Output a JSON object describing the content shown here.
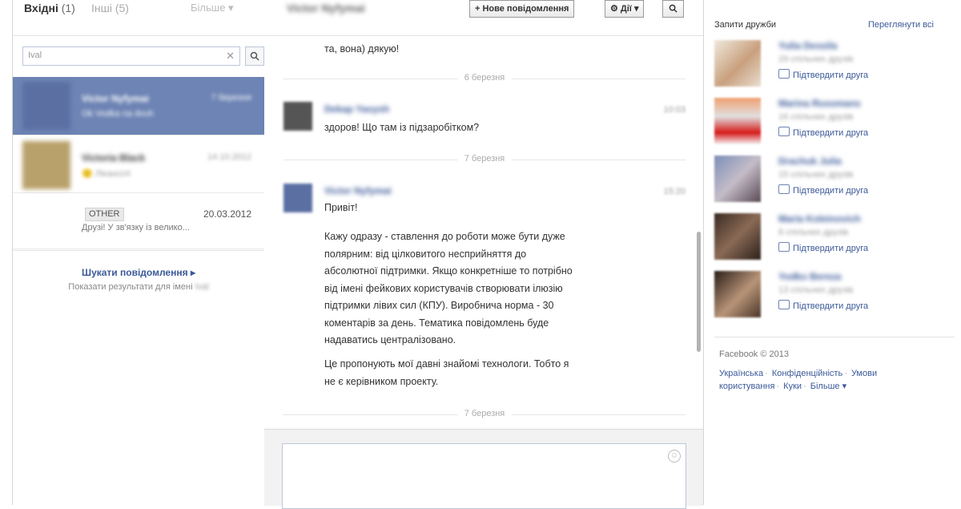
{
  "left": {
    "tabs": {
      "inbox": "Вхідні",
      "inbox_count": "(1)",
      "other": "Інші (5)",
      "more": "Більше ▾"
    },
    "search": {
      "value": "Ival",
      "clear": "✕",
      "button": "🔍"
    },
    "threads": [
      {
        "name": "Victor Nyfymai",
        "snippet": "Ok Vodka na dvuh",
        "date": "7 березня"
      },
      {
        "name": "Victoria Black",
        "snippet": "🙂 Лікансілї",
        "date": "14.10.2012"
      },
      {
        "badge": "OTHER",
        "date": "20.03.2012",
        "snippet": "Друзі! У зв'язку із велико..."
      }
    ],
    "search_messages": {
      "link": "Шукати повідомлення ▸",
      "sub": "Показати результати для імені",
      "sub_name": "Ival"
    }
  },
  "center": {
    "conversation_name": "Victor Nyfymai",
    "buttons": {
      "new_message": "+ Нове повідомлення",
      "actions": "⚙ Дії ▾",
      "search": "🔍"
    },
    "messages": {
      "top_fragment": "та, вона) дякую!",
      "divider_1": "6 березня",
      "msg1": {
        "name": "Dekap Yaoysh",
        "time": "10:03",
        "text": "здоров! Що там із підзаробітком?"
      },
      "divider_2": "7 березня",
      "msg2": {
        "name": "Victor Nyfymai",
        "time": "15:20",
        "greeting": "Привіт!",
        "p1": [
          "Кажу одразу - ставлення до роботи може бути дуже",
          "полярним: від цілковитого несприйняття до",
          "абсолютної підтримки. Якщо конкретніше то потрібно",
          "від імені фейкових користувачів створювати ілюзію",
          "підтримки лівих сил (КПУ). Виробнича норма - 30",
          "коментарів за день. Тематика повідомлень буде",
          "надаватись централізовано."
        ],
        "p2": [
          "Це пропонують мої давні знайомі технологи. Тобто я",
          "не є керівником проекту."
        ]
      },
      "divider_3": "7 березня"
    },
    "composer": {
      "emoji": "☺"
    }
  },
  "right": {
    "friend_requests_title": "Запити дружби",
    "see_all": "Переглянути всі",
    "requests": [
      {
        "name": "Yulia Dessila",
        "mutual": "29 спільних друзів",
        "confirm": "Підтвердити друга"
      },
      {
        "name": "Marina Russmans",
        "mutual": "16 спільних друзів",
        "confirm": "Підтвердити друга"
      },
      {
        "name": "Drachuk Julia",
        "mutual": "15 спільних друзів",
        "confirm": "Підтвердити друга"
      },
      {
        "name": "Maria Koleinovich",
        "mutual": "8 спільних друзів",
        "confirm": "Підтвердити друга"
      },
      {
        "name": "Yodko Bereza",
        "mutual": "13 спільних друзів",
        "confirm": "Підтвердити друга"
      }
    ],
    "footer": {
      "copyright": "Facebook © 2013",
      "links": [
        "Українська",
        "Конфіденційність",
        "Умови",
        "користування",
        "Куки",
        "Більше ▾"
      ]
    }
  },
  "colors": {
    "brand_blue": "#3b5998",
    "selected_thread": "#6d84b4",
    "border": "#d6d6d6"
  }
}
